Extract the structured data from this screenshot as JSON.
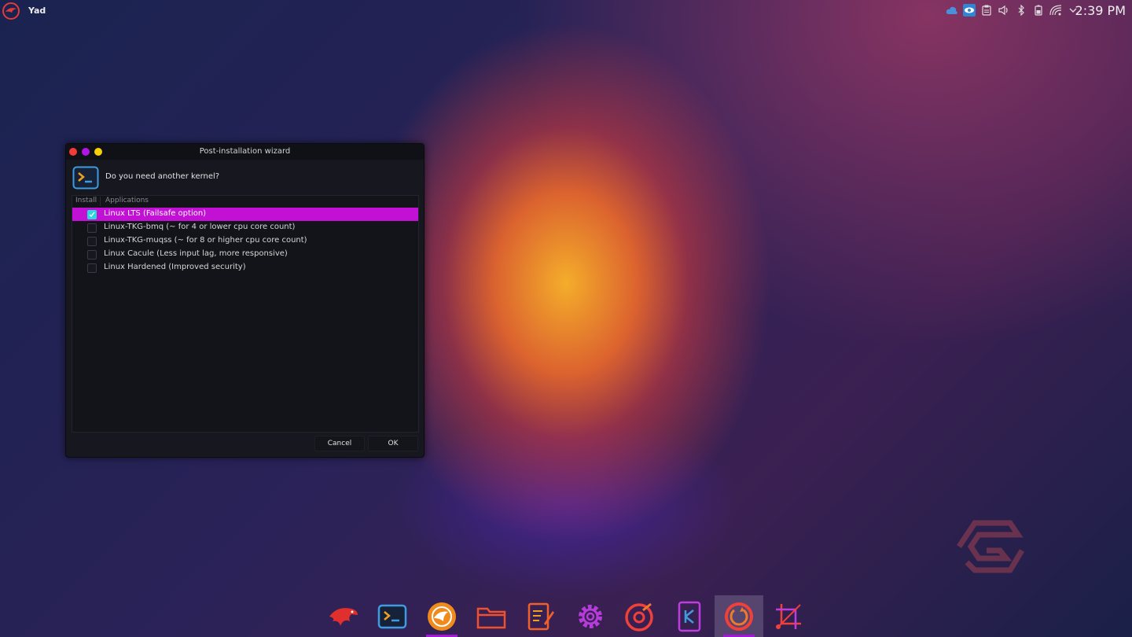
{
  "topbar": {
    "app_name": "Yad",
    "clock": "2:39 PM",
    "tray_icons": [
      "cloud-icon",
      "eye-icon",
      "clipboard-icon",
      "volume-icon",
      "bluetooth-icon",
      "battery-icon",
      "wifi-icon",
      "chevron-down-icon"
    ]
  },
  "dialog": {
    "title": "Post-installation wizard",
    "question": "Do you need another kernel?",
    "columns": {
      "install": "Install",
      "applications": "Applications"
    },
    "rows": [
      {
        "label": "Linux LTS (Failsafe option)",
        "checked": true,
        "selected": true
      },
      {
        "label": "Linux-TKG-bmq (~ for 4 or lower cpu core count)",
        "checked": false,
        "selected": false
      },
      {
        "label": "Linux-TKG-muqss (~ for 8 or higher cpu core count)",
        "checked": false,
        "selected": false
      },
      {
        "label": "Linux Cacule (Less input lag, more responsive)",
        "checked": false,
        "selected": false
      },
      {
        "label": "Linux Hardened (Improved security)",
        "checked": false,
        "selected": false
      }
    ],
    "buttons": {
      "cancel": "Cancel",
      "ok": "OK"
    }
  },
  "dock": {
    "items": [
      {
        "icon": "garuda-eagle-icon",
        "running": false,
        "active": false
      },
      {
        "icon": "terminal-icon",
        "running": false,
        "active": false
      },
      {
        "icon": "browser-icon",
        "running": true,
        "active": false
      },
      {
        "icon": "folder-icon",
        "running": false,
        "active": false
      },
      {
        "icon": "text-editor-icon",
        "running": false,
        "active": false
      },
      {
        "icon": "settings-gear-icon",
        "running": false,
        "active": false
      },
      {
        "icon": "disc-music-icon",
        "running": false,
        "active": false
      },
      {
        "icon": "kde-connect-icon",
        "running": false,
        "active": false
      },
      {
        "icon": "update-icon",
        "running": true,
        "active": true
      },
      {
        "icon": "screenshot-crop-icon",
        "running": false,
        "active": false
      }
    ]
  },
  "colors": {
    "selection": "#c211d4",
    "checkbox_checked": "#2ad9d9",
    "dock_indicator": "#a516d8"
  }
}
